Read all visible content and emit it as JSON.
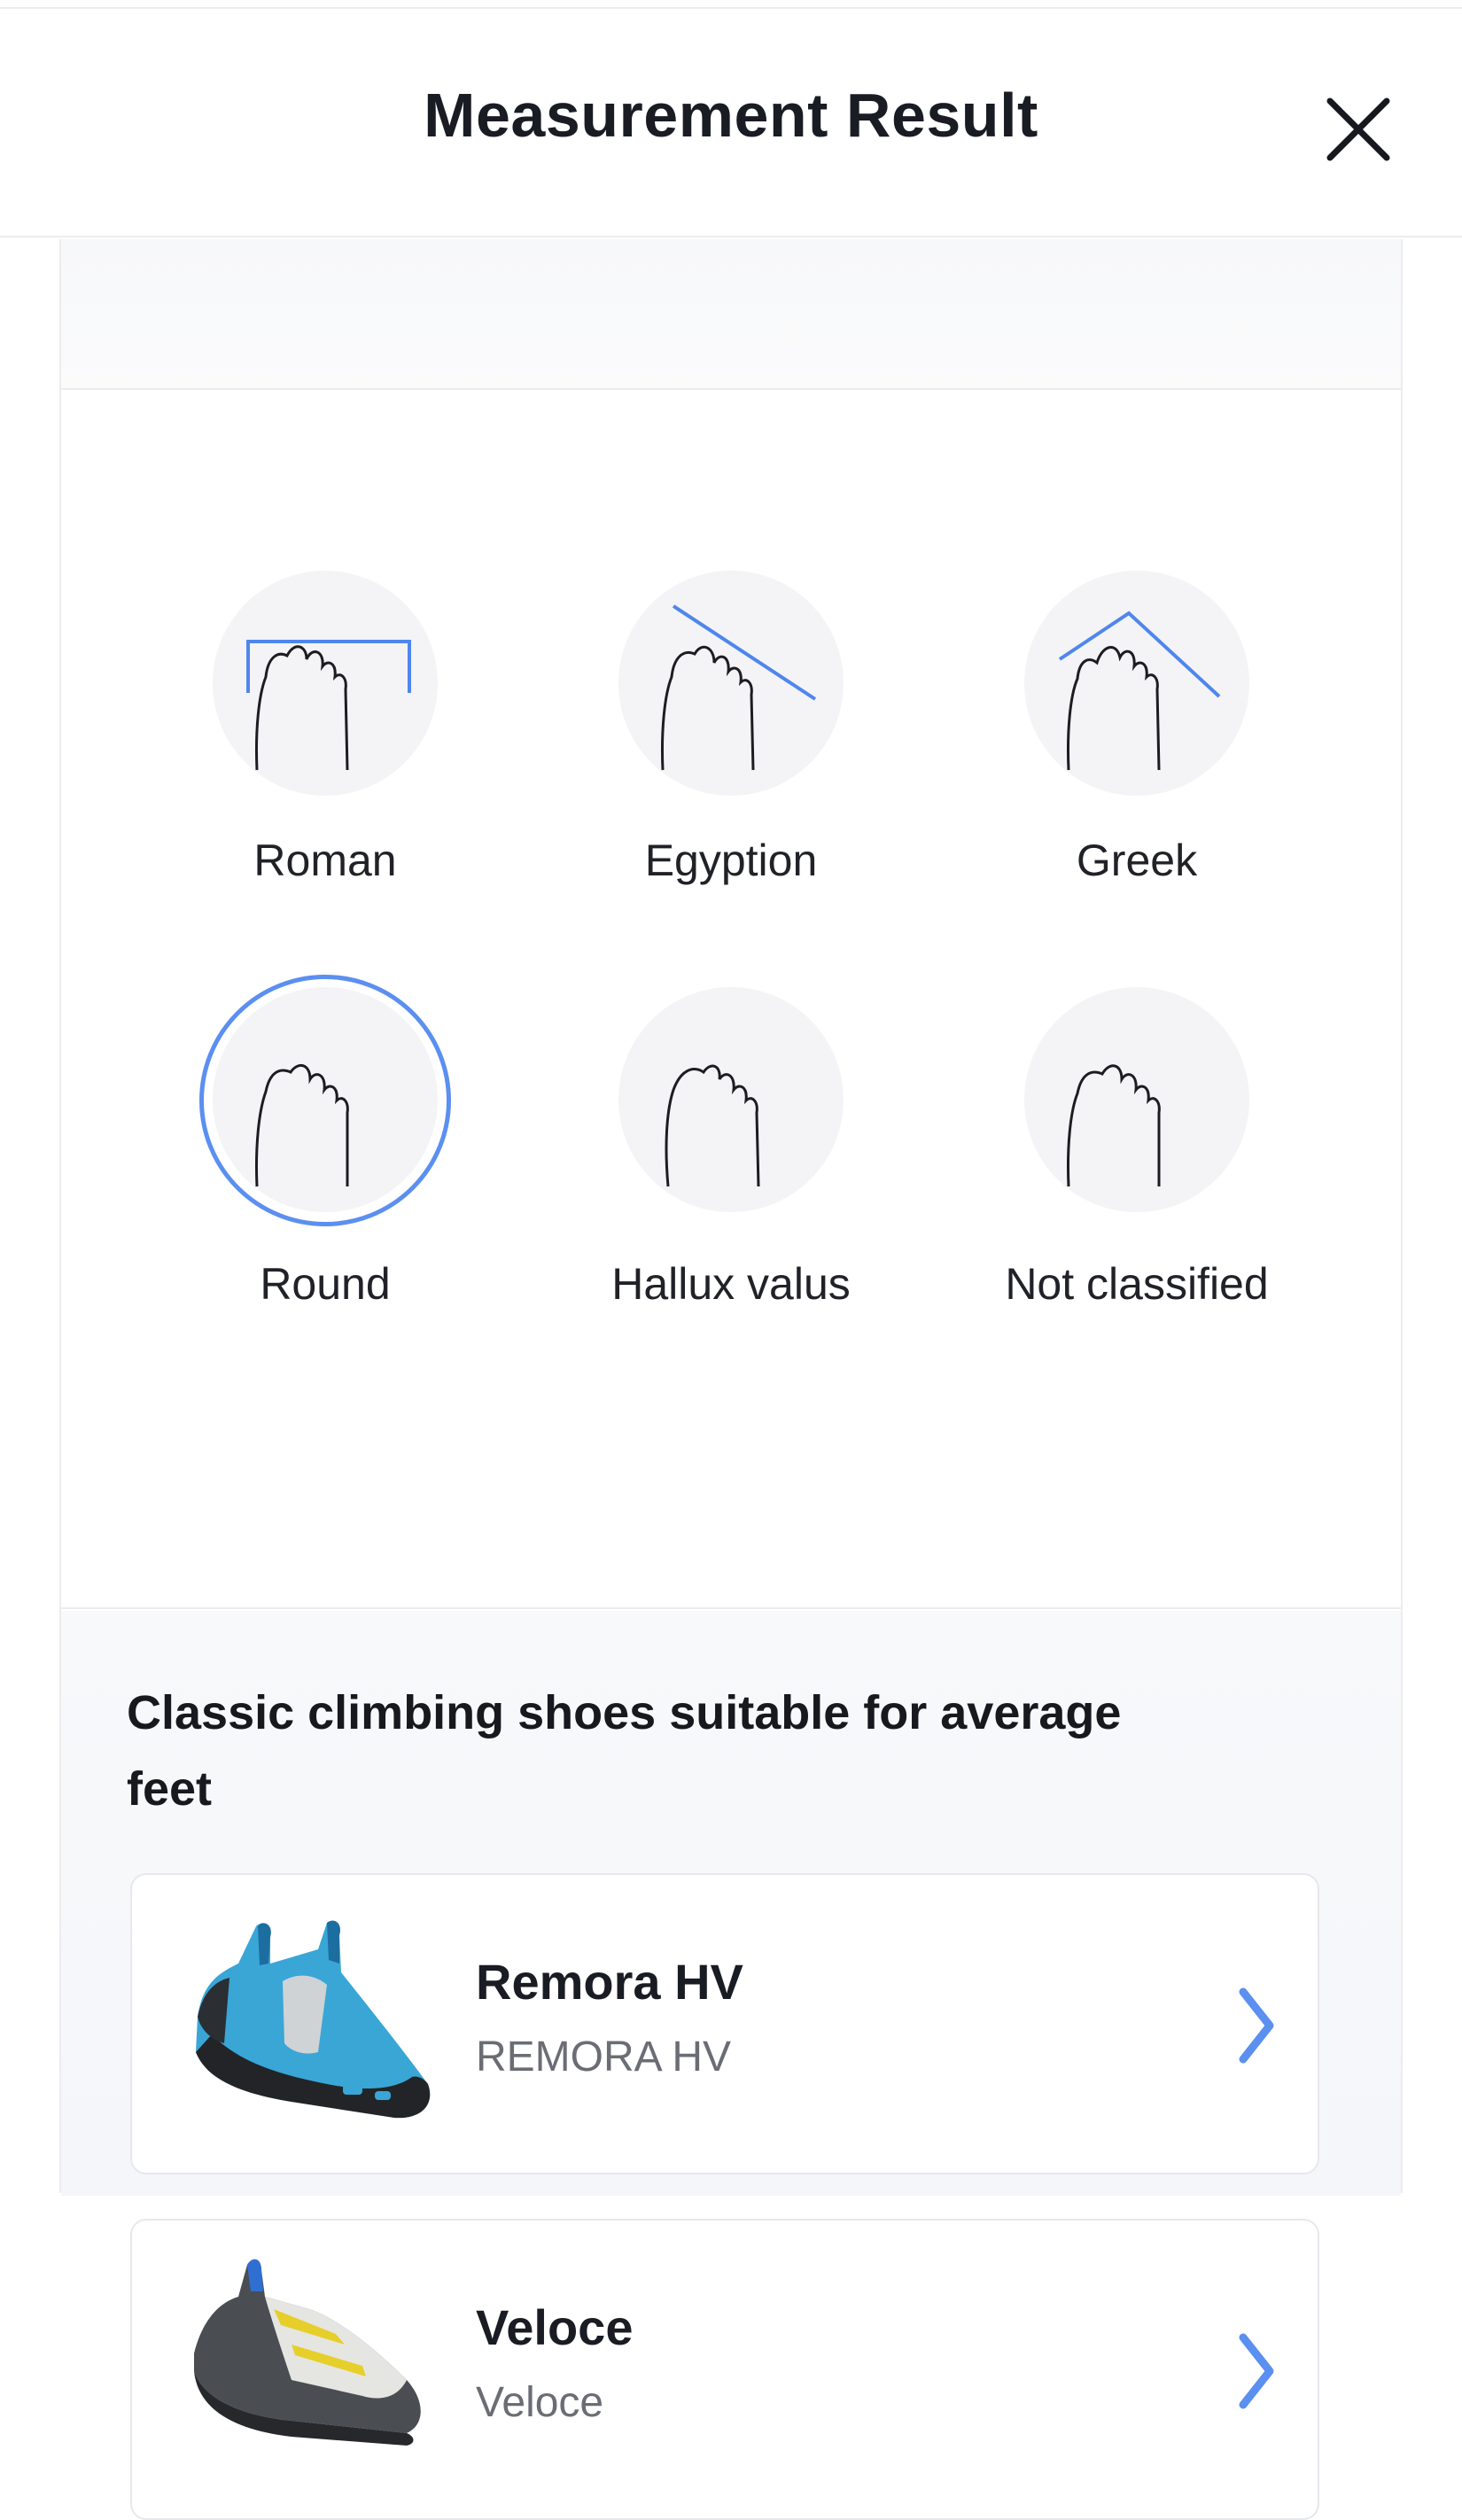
{
  "header": {
    "title": "Measurement Result",
    "close_icon": "close-icon"
  },
  "foot_types": [
    {
      "label": "Roman",
      "icon": "roman-toe-icon",
      "selected": false
    },
    {
      "label": "Egyption",
      "icon": "egyptian-toe-icon",
      "selected": false
    },
    {
      "label": "Greek",
      "icon": "greek-toe-icon",
      "selected": false
    },
    {
      "label": "Round",
      "icon": "round-toe-icon",
      "selected": true
    },
    {
      "label": "Hallux valus",
      "icon": "hallux-valgus-icon",
      "selected": false
    },
    {
      "label": "Not classified",
      "icon": "unclassified-toe-icon",
      "selected": false
    }
  ],
  "recommendations": {
    "title": "Classic climbing shoes suitable for average feet",
    "items": [
      {
        "name": "Remora HV",
        "subtitle": "REMORA HV",
        "image": "remora-shoe-image"
      },
      {
        "name": "Veloce",
        "subtitle": "Veloce",
        "image": "veloce-shoe-image"
      }
    ]
  },
  "colors": {
    "accent": "#5b8ff0",
    "guide_line": "#4f86ee",
    "circle_bg": "#f4f4f6",
    "divider": "#ececef"
  }
}
